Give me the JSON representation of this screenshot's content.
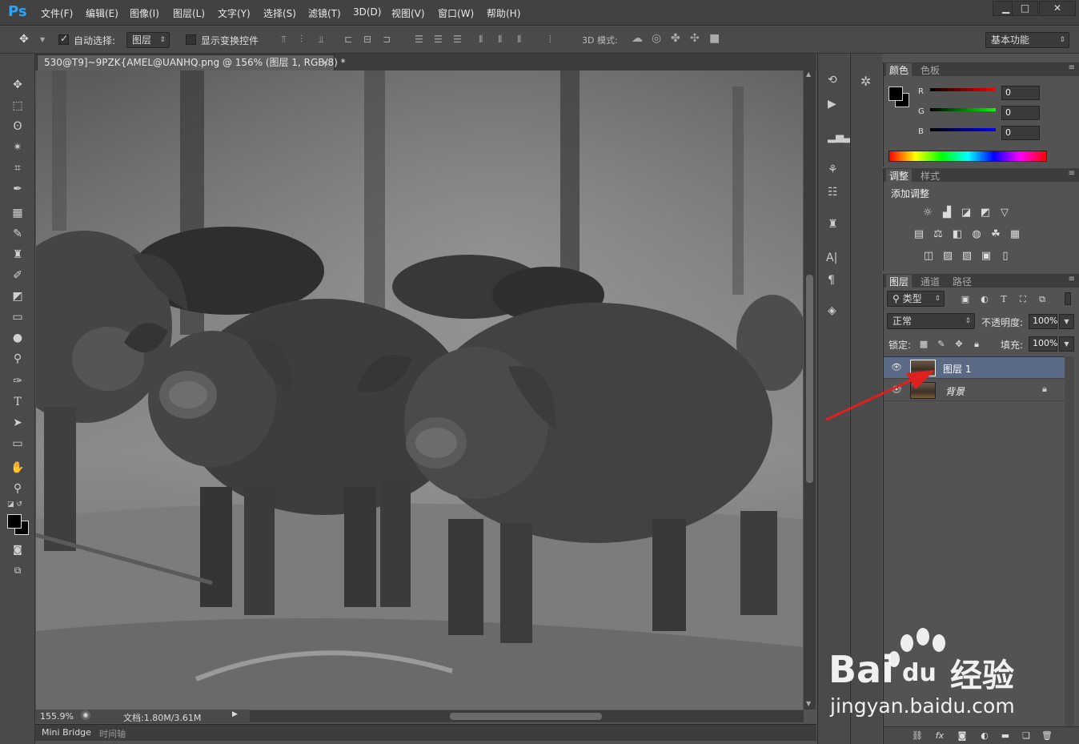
{
  "app": {
    "logo": "Ps"
  },
  "menu": [
    "文件(F)",
    "编辑(E)",
    "图像(I)",
    "图层(L)",
    "文字(Y)",
    "选择(S)",
    "滤镜(T)",
    "3D(D)",
    "视图(V)",
    "窗口(W)",
    "帮助(H)"
  ],
  "window_controls": {
    "minimize": "▁",
    "maximize": "□",
    "close": "✕"
  },
  "options": {
    "auto_select_label": "自动选择:",
    "auto_select_value": "图层",
    "show_transform_label": "显示变换控件",
    "mode_3d_label": "3D 模式:",
    "workspace": "基本功能"
  },
  "document": {
    "tab_title": "530@T9]~9PZK{AMEL@UANHQ.png @ 156% (图层 1, RGB/8) *",
    "zoom": "155.9%",
    "doc_size": "文档:1.80M/3.61M"
  },
  "bottom_tabs": {
    "mini_bridge": "Mini Bridge",
    "timeline": "时间轴"
  },
  "color_panel": {
    "tabs": [
      "颜色",
      "色板"
    ],
    "r_label": "R",
    "g_label": "G",
    "b_label": "B",
    "r": "0",
    "g": "0",
    "b": "0"
  },
  "adjust_panel": {
    "tabs": [
      "调整",
      "样式"
    ],
    "heading": "添加调整"
  },
  "layers_panel": {
    "tabs": [
      "图层",
      "通道",
      "路径"
    ],
    "filter_kind": "类型",
    "blend_mode": "正常",
    "opacity_label": "不透明度:",
    "opacity": "100%",
    "lock_label": "锁定:",
    "fill_label": "填充:",
    "fill": "100%",
    "layers": [
      {
        "name": "图层 1",
        "selected": true
      },
      {
        "name": "背景",
        "selected": false
      }
    ]
  },
  "watermark": {
    "brand": "Bai",
    "brand2": "du",
    "cn": "经验",
    "url": "jingyan.baidu.com"
  },
  "colors": {
    "accent_red": "#e02020",
    "ps_blue": "#2fa3f7",
    "watermark": "#ffffff"
  }
}
